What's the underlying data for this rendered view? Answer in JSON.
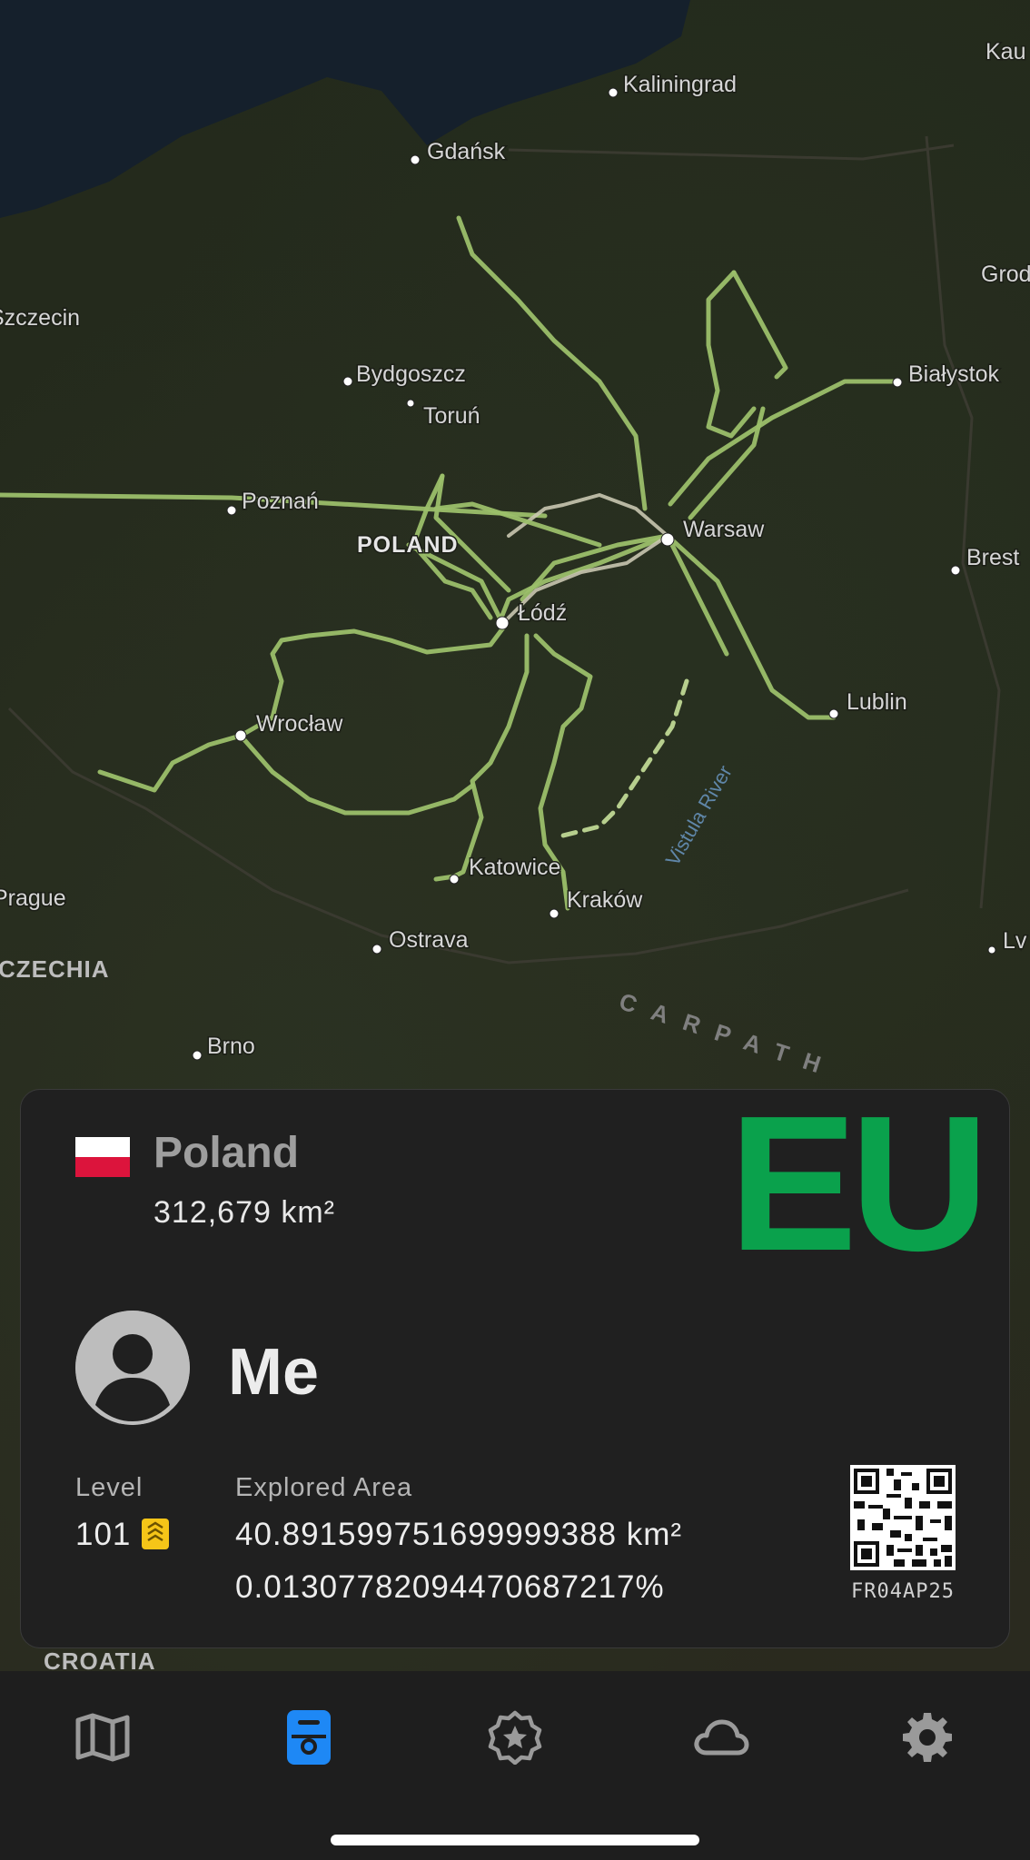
{
  "map": {
    "cities": [
      {
        "name": "Kaliningrad"
      },
      {
        "name": "Gdańsk"
      },
      {
        "name": "Szczecin"
      },
      {
        "name": "Bydgoszcz"
      },
      {
        "name": "Toruń"
      },
      {
        "name": "Białystok"
      },
      {
        "name": "Poznań"
      },
      {
        "name": "Warsaw"
      },
      {
        "name": "Łódź"
      },
      {
        "name": "Brest"
      },
      {
        "name": "Lublin"
      },
      {
        "name": "Wrocław"
      },
      {
        "name": "Katowice"
      },
      {
        "name": "Kraków"
      },
      {
        "name": "Ostrava"
      },
      {
        "name": "Brno"
      },
      {
        "name": "Prague"
      },
      {
        "name": "Grod"
      },
      {
        "name": "Kau"
      },
      {
        "name": "Lv"
      }
    ],
    "country_label": "POLAND",
    "region_labels": {
      "czechia": "CZECHIA",
      "croatia": "CROATIA",
      "carpathians": "CARPATH",
      "vistula": "Vistula River"
    }
  },
  "card": {
    "region_badge": "EU",
    "country": {
      "name": "Poland",
      "area": "312,679 km²",
      "flag_colors": [
        "#ffffff",
        "#dc143c"
      ]
    },
    "user": {
      "name": "Me"
    },
    "level": {
      "label": "Level",
      "value": "101"
    },
    "explored": {
      "label": "Explored Area",
      "km": "40.891599751699999388 km²",
      "percent": "0.01307782094470687217%"
    },
    "qr_code": "FR04AP25",
    "accent_color": "#0aa14c"
  },
  "tabs": [
    {
      "icon": "map-icon",
      "active": false
    },
    {
      "icon": "profile-card-icon",
      "active": true
    },
    {
      "icon": "badge-star-icon",
      "active": false
    },
    {
      "icon": "cloud-icon",
      "active": false
    },
    {
      "icon": "gear-icon",
      "active": false
    }
  ],
  "colors": {
    "active_tab": "#1e88f5",
    "inactive_tab": "#9a9a9a",
    "track": "#9bbf6a"
  }
}
